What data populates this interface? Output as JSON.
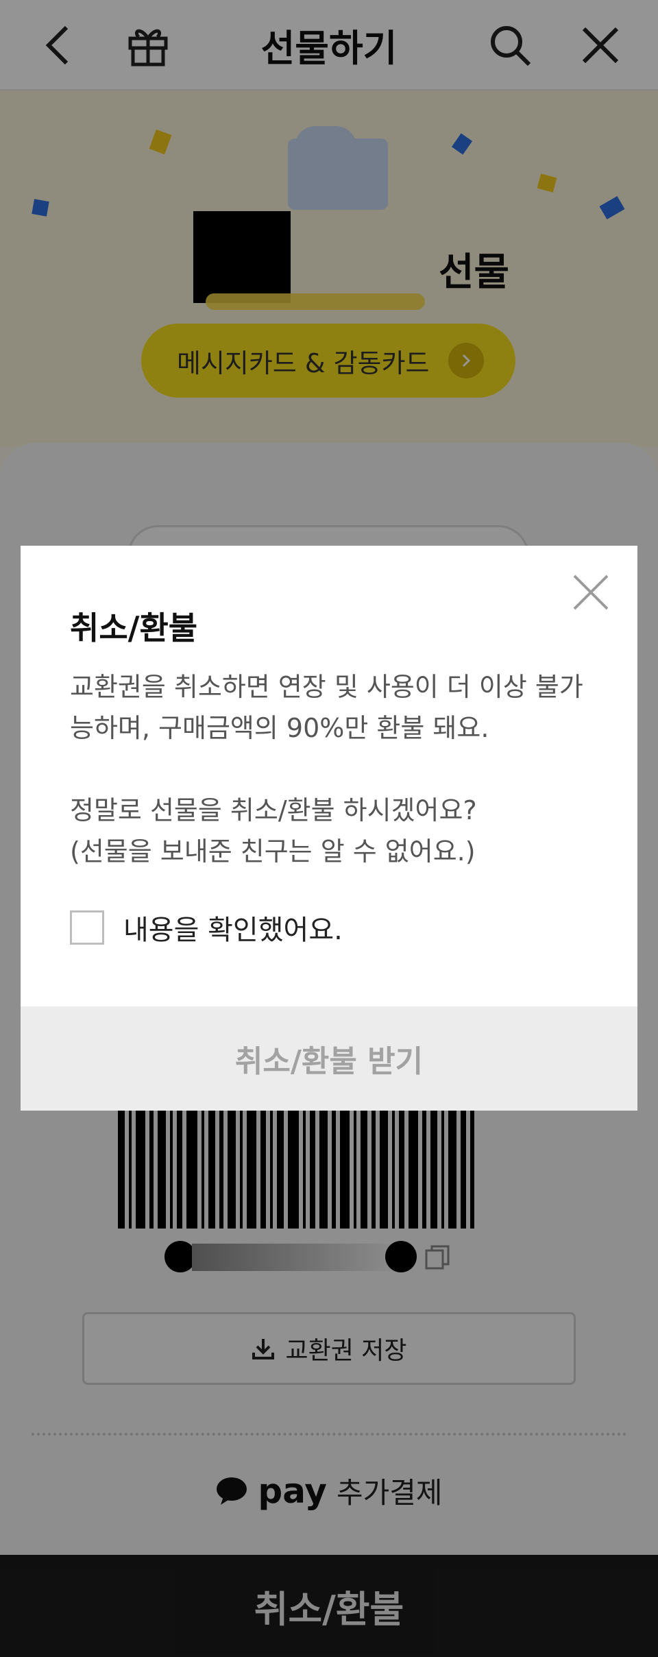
{
  "header": {
    "title": "선물하기",
    "back_icon": "chevron-left-icon",
    "gift_icon": "gift-icon",
    "search_icon": "search-icon",
    "close_icon": "close-icon"
  },
  "hero": {
    "gift_suffix": "선물",
    "message_card_button": "메시지카드 & 감동카드"
  },
  "voucher": {
    "save_button": "교환권 저장",
    "pay_brand": "pay",
    "pay_extra": "추가결제"
  },
  "bottom_bar": {
    "label": "취소/환불"
  },
  "modal": {
    "title": "취소/환불",
    "body_line1": "교환권을 취소하면 연장 및 사용이 더 이상 불가능하며, 구매금액의 90%만 환불 돼요.",
    "body_line2": "정말로 선물을 취소/환불 하시겠어요?",
    "body_line3": "(선물을 보내준 친구는 알 수 없어요.)",
    "checkbox_label": "내용을 확인했어요.",
    "checkbox_checked": false,
    "confirm_button": "취소/환불 받기"
  },
  "colors": {
    "accent_yellow": "#F7DF1E",
    "dim_overlay": "#000000",
    "bottom_bar": "#1B1B1B"
  }
}
